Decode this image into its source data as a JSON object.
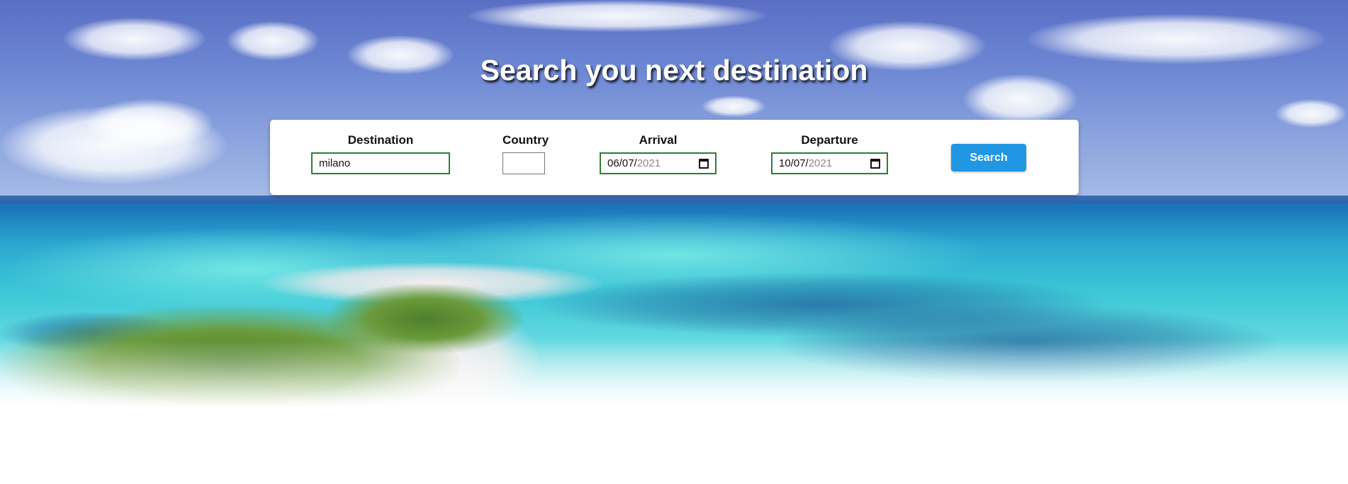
{
  "hero": {
    "title": "Search you next destination"
  },
  "search_form": {
    "destination": {
      "label": "Destination",
      "value": "milano"
    },
    "country": {
      "label": "Country",
      "value": ""
    },
    "arrival": {
      "label": "Arrival",
      "day_month": "06/07/",
      "year": "2021"
    },
    "departure": {
      "label": "Departure",
      "day_month": "10/07/",
      "year": "2021"
    },
    "search_button_label": "Search"
  },
  "icons": {
    "calendar": "calendar-icon"
  },
  "colors": {
    "button": "#2196e3",
    "valid_border": "#2e7d32",
    "title_text": "#ffffff"
  }
}
